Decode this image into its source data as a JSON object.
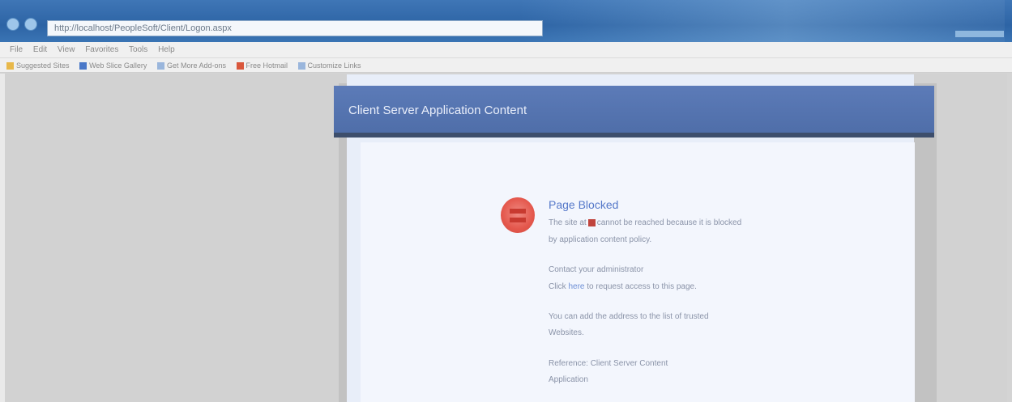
{
  "browser": {
    "address": "http://localhost/PeopleSoft/Client/Logon.aspx",
    "menu": [
      "File",
      "Edit",
      "View",
      "Favorites",
      "Tools",
      "Help"
    ],
    "favorites": [
      "Suggested Sites",
      "Web Slice Gallery",
      "Get More Add-ons",
      "Free Hotmail",
      "Customize Links"
    ]
  },
  "dialog": {
    "title": "Client Server Application Content",
    "error_heading": "Page Blocked",
    "lines": {
      "l1_before": "The site at",
      "l1_after": "cannot be reached because it is blocked",
      "l2": "by application content policy.",
      "l3": "Contact your administrator",
      "l4_before": "Click",
      "l4_link": "here",
      "l4_after": "to request access to this page.",
      "l5": "You can add the address to the list of trusted",
      "l6": "Websites.",
      "l7": "Reference: Client Server Content",
      "l8": "Application"
    }
  }
}
